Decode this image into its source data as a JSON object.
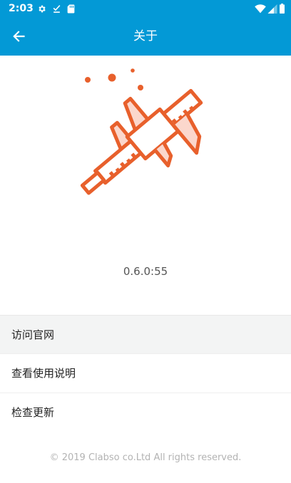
{
  "status_bar": {
    "time": "2:03",
    "left_icons": [
      "gear-icon",
      "download-done-icon",
      "sd-card-icon"
    ],
    "right_icons": [
      "wifi-icon",
      "signal-icon",
      "battery-icon"
    ],
    "background_color": "#0399d6"
  },
  "app_bar": {
    "title": "关于",
    "back_icon": "arrow-back-icon",
    "background_color": "#0399d6"
  },
  "logo": {
    "icon": "caliper-icon",
    "accent_color": "#e8602c"
  },
  "version": "0.6.0:55",
  "menu": {
    "items": [
      {
        "label": "访问官网"
      },
      {
        "label": "查看使用说明"
      },
      {
        "label": "检查更新"
      }
    ]
  },
  "footer": {
    "copyright": "© 2019 Clabso co.Ltd All rights reserved."
  }
}
